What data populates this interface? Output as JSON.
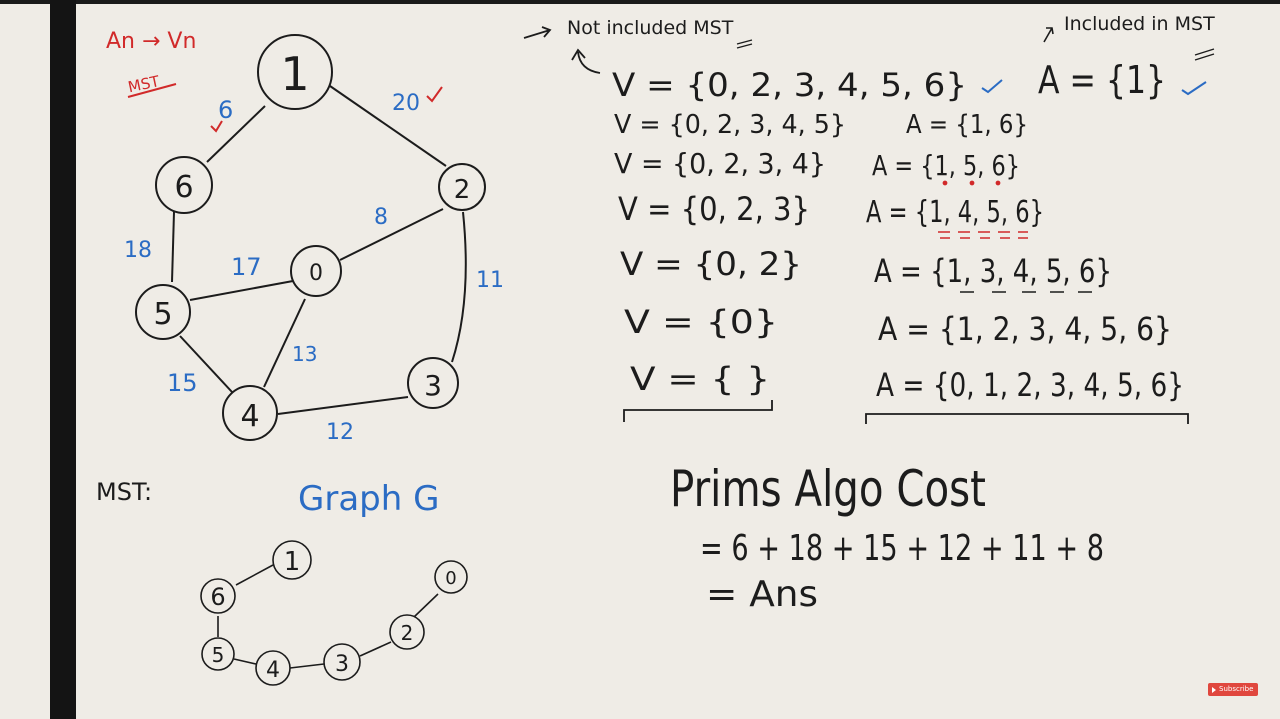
{
  "top_note": {
    "title": "An → Vn",
    "subtitle": "MST"
  },
  "graph_labels": {
    "mst": "MST:",
    "graph": "Graph G"
  },
  "graph": {
    "nodes": [
      {
        "id": "1",
        "label": "1"
      },
      {
        "id": "6",
        "label": "6"
      },
      {
        "id": "2",
        "label": "2"
      },
      {
        "id": "0",
        "label": "0"
      },
      {
        "id": "5",
        "label": "5"
      },
      {
        "id": "4",
        "label": "4"
      },
      {
        "id": "3",
        "label": "3"
      }
    ],
    "edges": [
      {
        "from": "1",
        "to": "6",
        "weight": "6"
      },
      {
        "from": "1",
        "to": "2",
        "weight": "20"
      },
      {
        "from": "6",
        "to": "5",
        "weight": "18"
      },
      {
        "from": "2",
        "to": "0",
        "weight": "8"
      },
      {
        "from": "5",
        "to": "0",
        "weight": "17"
      },
      {
        "from": "2",
        "to": "3",
        "weight": "11"
      },
      {
        "from": "0",
        "to": "4",
        "weight": "13"
      },
      {
        "from": "5",
        "to": "4",
        "weight": "15"
      },
      {
        "from": "4",
        "to": "3",
        "weight": "12"
      }
    ]
  },
  "mst_tree": {
    "nodes": [
      "1",
      "6",
      "5",
      "4",
      "3",
      "2",
      "0"
    ]
  },
  "headers": {
    "not_included": "Not included MST",
    "included": "Included in MST"
  },
  "steps": {
    "v_sets": [
      "V = {0, 2, 3, 4, 5, 6}",
      "V = {0, 2, 3, 4, 5}",
      "V = {0, 2, 3, 4}",
      "V = {0, 2, 3}",
      "V = {0, 2}",
      "V = {0}",
      "V = { }"
    ],
    "a_sets": [
      "A = {1}",
      "A = {1, 6}",
      "A = {1, 5, 6}",
      "A = {1, 4, 5, 6}",
      "A = {1, 3, 4, 5, 6}",
      "A = {1, 2, 3, 4, 5, 6}",
      "A = {0, 1, 2, 3, 4, 5, 6}"
    ]
  },
  "cost": {
    "title": "Prims Algo Cost",
    "sum": "= 6 + 18 + 15 + 12 + 11 + 8",
    "answer": "= Ans"
  },
  "subscribe": {
    "label": "Subscribe"
  },
  "colors": {
    "background": "#efece6",
    "ink": "#1c1c1c",
    "blue": "#2b6cc4",
    "red": "#d12a2a",
    "left_bar": "#141414"
  }
}
